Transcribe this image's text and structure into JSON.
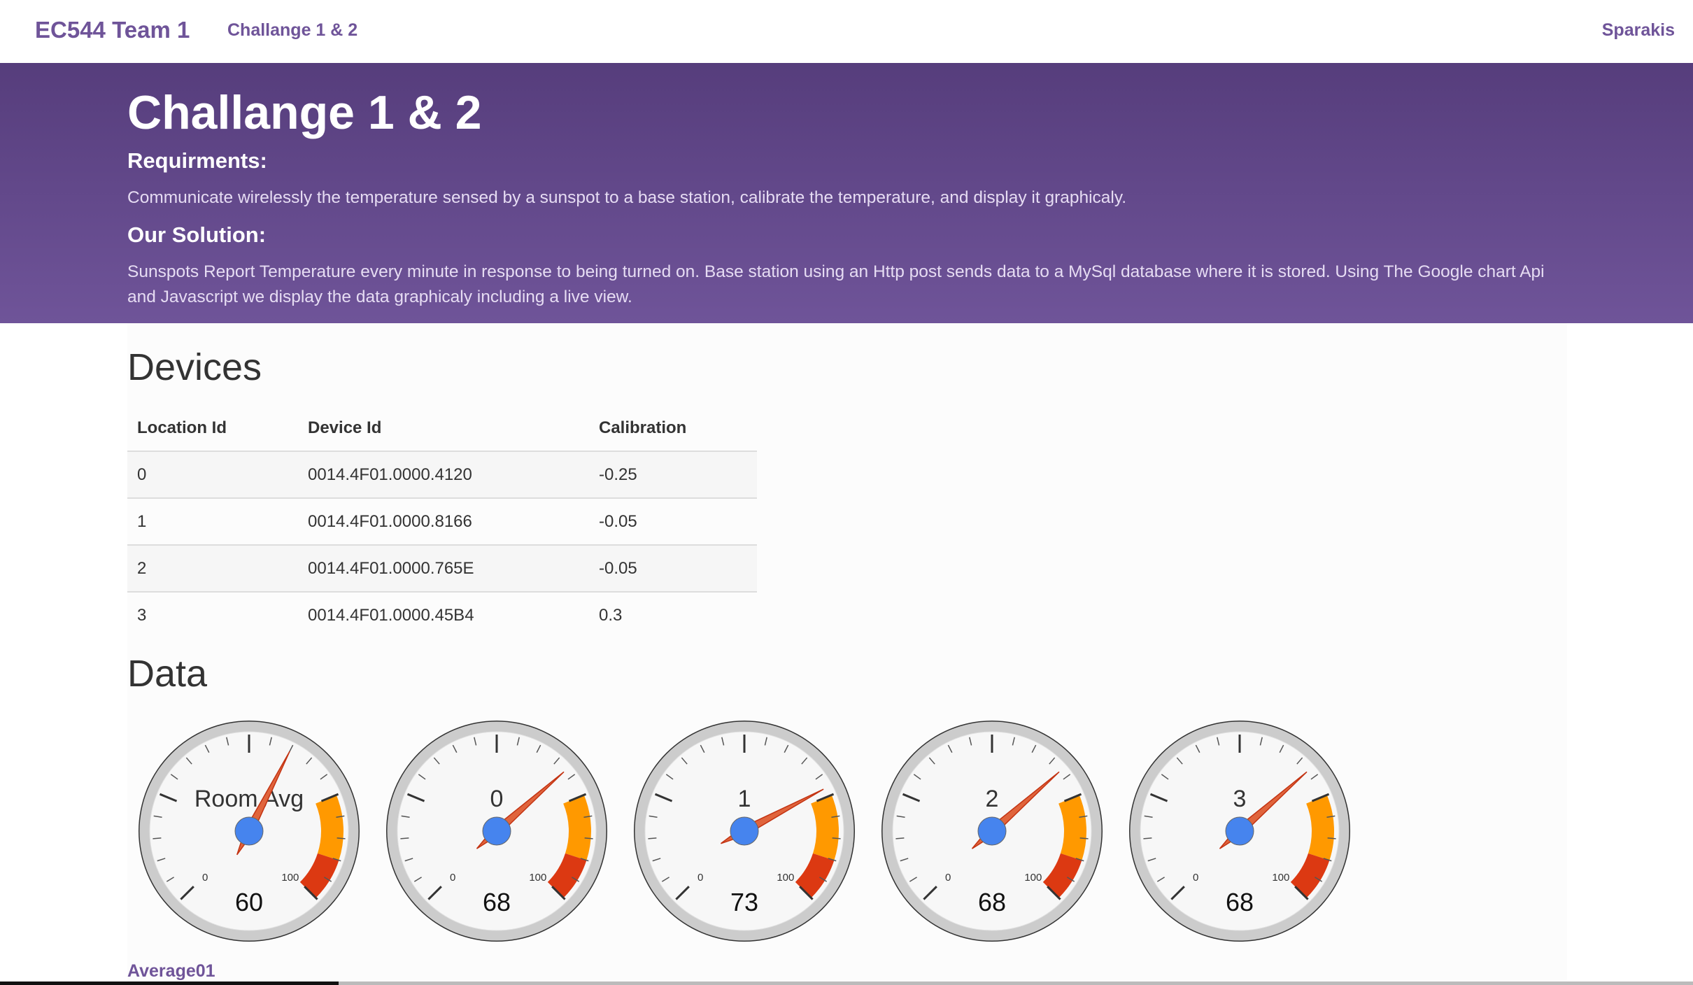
{
  "nav": {
    "brand": "EC544 Team 1",
    "link": "Challange 1 & 2",
    "right_link": "Sparakis"
  },
  "hero": {
    "title": "Challange 1 & 2",
    "requirements_heading": "Requirments:",
    "requirements_text": "Communicate wirelessly the temperature sensed by a sunspot to a base station, calibrate the temperature, and display it graphicaly.",
    "solution_heading": "Our Solution:",
    "solution_text": "Sunspots Report Temperature every minute in response to being turned on. Base station using an Http post sends data to a MySql database where it is stored. Using The Google chart Api and Javascript we display the data graphicaly including a live view."
  },
  "devices": {
    "heading": "Devices",
    "columns": [
      "Location Id",
      "Device Id",
      "Calibration"
    ],
    "rows": [
      [
        "0",
        "0014.4F01.0000.4120",
        "-0.25"
      ],
      [
        "1",
        "0014.4F01.0000.8166",
        "-0.05"
      ],
      [
        "2",
        "0014.4F01.0000.765E",
        "-0.05"
      ],
      [
        "3",
        "0014.4F01.0000.45B4",
        "0.3"
      ]
    ]
  },
  "data": {
    "heading": "Data",
    "gauges": [
      {
        "label": "Room Avg",
        "value": 60,
        "min_label": "0",
        "max_label": "100"
      },
      {
        "label": "0",
        "value": 68,
        "min_label": "0",
        "max_label": "100"
      },
      {
        "label": "1",
        "value": 73,
        "min_label": "0",
        "max_label": "100"
      },
      {
        "label": "2",
        "value": 68,
        "min_label": "0",
        "max_label": "100"
      },
      {
        "label": "3",
        "value": 68,
        "min_label": "0",
        "max_label": "100"
      }
    ],
    "yellow_band": [
      75,
      90
    ],
    "red_band": [
      90,
      100
    ],
    "average_link": "Average01"
  },
  "colors": {
    "accent": "#6f5499",
    "hero_top": "#563d7c",
    "hero_bottom": "#6f5499",
    "gauge_yellow": "#ff9900",
    "gauge_red": "#dc3912",
    "needle": "#dc3912",
    "hub": "#4684ee"
  }
}
